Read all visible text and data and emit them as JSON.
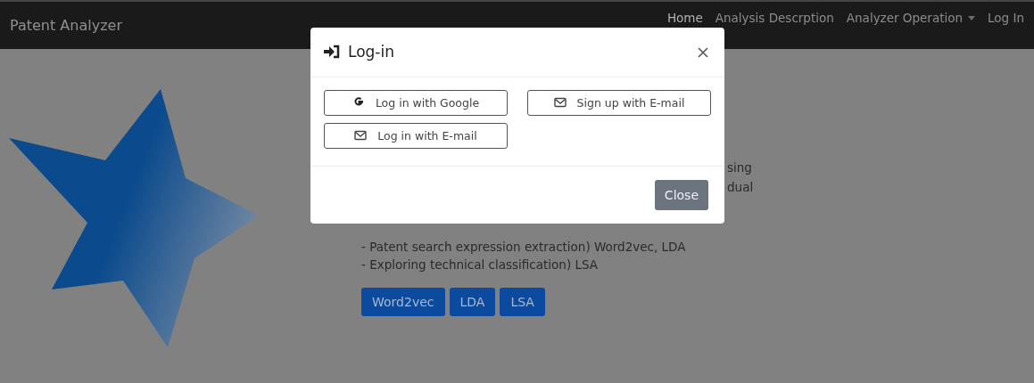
{
  "navbar": {
    "brand": "Patent Analyzer",
    "items": [
      {
        "label": "Home",
        "kind": "link",
        "selected": true
      },
      {
        "label": "Analysis Descrption",
        "kind": "link",
        "selected": false
      },
      {
        "label": "Analyzer Operation",
        "kind": "dropdown",
        "selected": false
      },
      {
        "label": "Log In",
        "kind": "link",
        "selected": false
      }
    ]
  },
  "content": {
    "hidden_line_ends": [
      "sing",
      "dual"
    ],
    "bullets": [
      "- Patent search expression extraction) Word2vec, LDA",
      "- Exploring technical classification) LSA"
    ],
    "buttons": [
      "Word2vec",
      "LDA",
      "LSA"
    ]
  },
  "modal": {
    "title": "Log-in",
    "login_options": [
      {
        "label": "Log in with Google",
        "kind": "google"
      },
      {
        "label": "Sign up with E-mail",
        "kind": "email"
      },
      {
        "label": "Log in with E-mail",
        "kind": "email"
      }
    ],
    "close_button": "Close"
  }
}
